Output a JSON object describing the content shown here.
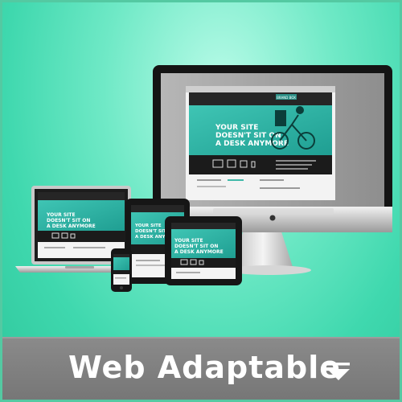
{
  "banner": {
    "title": "Web Adaptable",
    "dropdown_icon": "triangle-down-icon",
    "accent_color": "#3fd8ae",
    "footer_color": "#808080"
  },
  "mockup_site": {
    "brand": "BRAND BOX",
    "hero_line1": "YOUR SITE",
    "hero_line2": "DOESN'T SIT ON",
    "hero_line3": "A DESK ANYMORE"
  }
}
